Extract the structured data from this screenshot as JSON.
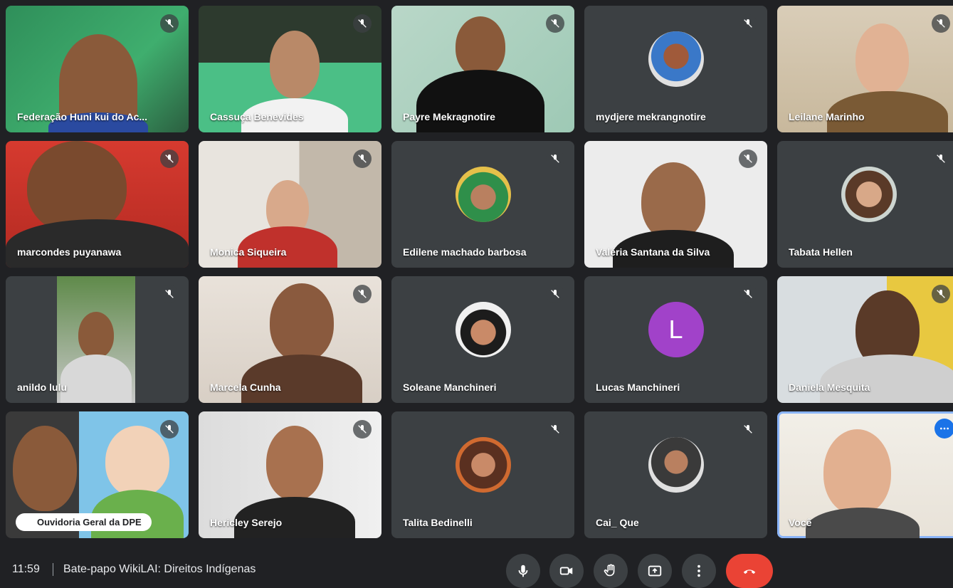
{
  "participants": [
    {
      "name": "Federação Huni kui do Ac...",
      "kind": "video"
    },
    {
      "name": "Cassuça Benevides",
      "kind": "video"
    },
    {
      "name": "Payre Mekragnotire",
      "kind": "video"
    },
    {
      "name": "mydjere mekrangnotire",
      "kind": "avatar"
    },
    {
      "name": "Leilane Marinho",
      "kind": "video"
    },
    {
      "name": "marcondes puyanawa",
      "kind": "video"
    },
    {
      "name": "Monica Siqueira",
      "kind": "video"
    },
    {
      "name": "Edilene machado barbosa",
      "kind": "avatar"
    },
    {
      "name": "Valéria Santana da Silva",
      "kind": "video"
    },
    {
      "name": "Tabata Hellen",
      "kind": "avatar"
    },
    {
      "name": "anildo lulu",
      "kind": "video"
    },
    {
      "name": "Marcela Cunha",
      "kind": "video"
    },
    {
      "name": "Soleane Manchineri",
      "kind": "avatar"
    },
    {
      "name": "Lucas Manchineri",
      "kind": "letter",
      "letter": "L",
      "color": "#a142c9"
    },
    {
      "name": "Daniela Mesquita",
      "kind": "video"
    },
    {
      "name": "Ouvidoria Geral da DPE",
      "kind": "video"
    },
    {
      "name": "Hericley Serejo",
      "kind": "video"
    },
    {
      "name": "Talita Bedinelli",
      "kind": "avatar"
    },
    {
      "name": "Cai_ Que",
      "kind": "avatar"
    },
    {
      "name": "Você",
      "kind": "video"
    }
  ],
  "bottombar": {
    "time": "11:59",
    "meeting_title": "Bate-papo WikiLAI: Direitos Indígenas"
  },
  "icons": {
    "mute": "mic-off-icon",
    "mic": "mic-icon",
    "camera": "camera-icon",
    "raise_hand": "raise-hand-icon",
    "present": "present-icon",
    "more": "more-options-icon",
    "end_call": "end-call-icon"
  },
  "colors": {
    "background": "#202124",
    "tile": "#3c4043",
    "end_call": "#ea4335",
    "active_outline": "#8ab4f8"
  }
}
